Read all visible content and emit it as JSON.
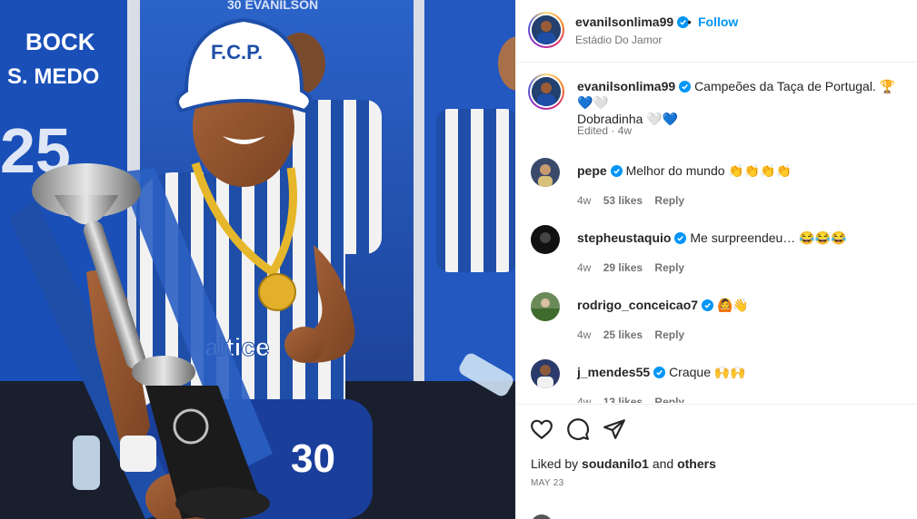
{
  "post": {
    "username": "evanilsonlima99",
    "follow_label": "Follow",
    "dot": "•",
    "location": "Estádio Do Jamor",
    "caption_text": "Campeões da Taça de Portugal. 🏆💙🤍",
    "caption_line2": "Dobradinha 🤍💙",
    "caption_meta": "Edited · 4w",
    "liked_prefix": "Liked by ",
    "liked_user": "soudanilo1",
    "liked_mid": " and ",
    "liked_suffix": "others",
    "date": "MAY 23"
  },
  "photo": {
    "hat_text": "F.C.P.",
    "locker_name": "BOCK",
    "locker_name2": "S. MEDO",
    "locker_number": "25",
    "jersey_sponsor": "altice",
    "shorts_number": "30",
    "banner_text": "30 EVANILSON"
  },
  "comments": [
    {
      "user": "pepe",
      "text": "Melhor do mundo 👏👏👏👏",
      "time": "4w",
      "likes": "53 likes",
      "reply": "Reply",
      "verified": true,
      "avatar_color": "#3a4a6b"
    },
    {
      "user": "stepheustaquio",
      "text": "Me surpreendeu… 😂😂😂",
      "time": "4w",
      "likes": "29 likes",
      "reply": "Reply",
      "verified": true,
      "avatar_color": "#111111"
    },
    {
      "user": "rodrigo_conceicao7",
      "text": "🙆👋",
      "time": "4w",
      "likes": "25 likes",
      "reply": "Reply",
      "verified": true,
      "avatar_color": "#6b8a5a"
    },
    {
      "user": "j_mendes55",
      "text": "Craque 🙌🙌",
      "time": "4w",
      "likes": "13 likes",
      "reply": "Reply",
      "verified": true,
      "avatar_color": "#2a3a6a"
    }
  ],
  "colors": {
    "follow_blue": "#0095f6",
    "verified_blue": "#0095f6",
    "porto_blue": "#1e4ea8"
  },
  "icons": [
    "heart-icon",
    "comment-icon",
    "share-icon",
    "verified-icon"
  ]
}
